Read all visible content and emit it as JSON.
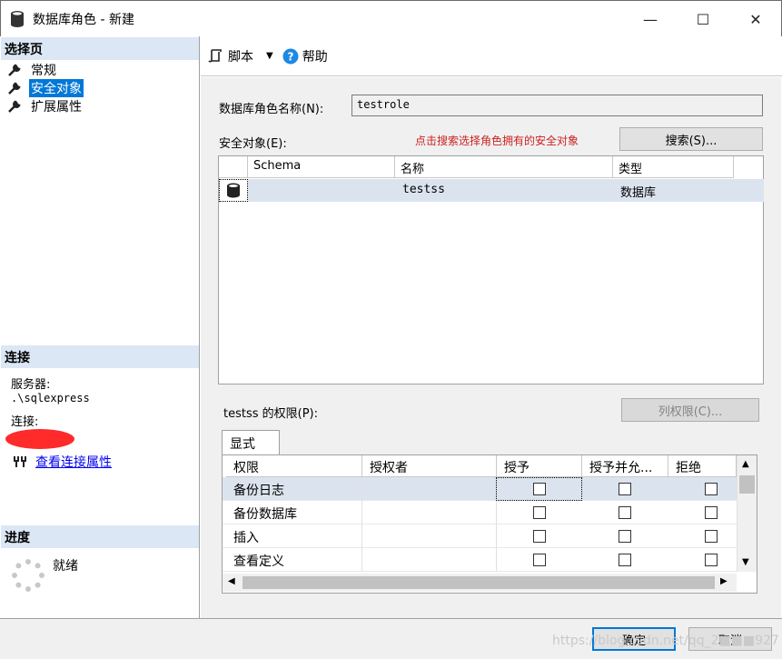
{
  "window": {
    "title": "数据库角色 - 新建",
    "minimize_glyph": "—",
    "maximize_glyph": "☐",
    "close_glyph": "✕"
  },
  "sidebar": {
    "select_page_header": "选择页",
    "items": [
      {
        "label": "常规",
        "icon": "wrench-icon",
        "selected": false
      },
      {
        "label": "安全对象",
        "icon": "wrench-icon",
        "selected": true
      },
      {
        "label": "扩展属性",
        "icon": "wrench-icon",
        "selected": false
      }
    ],
    "connection_header": "连接",
    "server_label": "服务器:",
    "server_value": ".\\sqlexpress",
    "connection_label": "连接:",
    "view_connection_link": "查看连接属性",
    "progress_header": "进度",
    "progress_status": "就绪"
  },
  "toolbar": {
    "script_label": "脚本",
    "help_label": "帮助"
  },
  "form": {
    "role_name_label": "数据库角色名称(N):",
    "role_name_value": "testrole",
    "securables_label": "安全对象(E):",
    "hint_text": "点击搜索选择角色拥有的安全对象",
    "search_button": "搜索(S)..."
  },
  "securables_table": {
    "columns": [
      "Schema",
      "名称",
      "类型"
    ],
    "rows": [
      {
        "schema": "",
        "name": "testss",
        "type": "数据库"
      }
    ]
  },
  "permissions": {
    "label": "testss 的权限(P):",
    "column_permissions_button": "列权限(C)...",
    "tab_label": "显式",
    "columns": [
      "权限",
      "授权者",
      "授予",
      "授予并允...",
      "拒绝"
    ],
    "rows": [
      {
        "permission": "备份日志",
        "grantor": "",
        "grant": false,
        "with_grant": false,
        "deny": false
      },
      {
        "permission": "备份数据库",
        "grantor": "",
        "grant": false,
        "with_grant": false,
        "deny": false
      },
      {
        "permission": "插入",
        "grantor": "",
        "grant": false,
        "with_grant": false,
        "deny": false
      },
      {
        "permission": "查看定义",
        "grantor": "",
        "grant": false,
        "with_grant": false,
        "deny": false
      }
    ]
  },
  "buttons": {
    "ok": "确定",
    "cancel": "取消"
  },
  "watermark": "https://blog.csdn.net/qq_2■■■927"
}
